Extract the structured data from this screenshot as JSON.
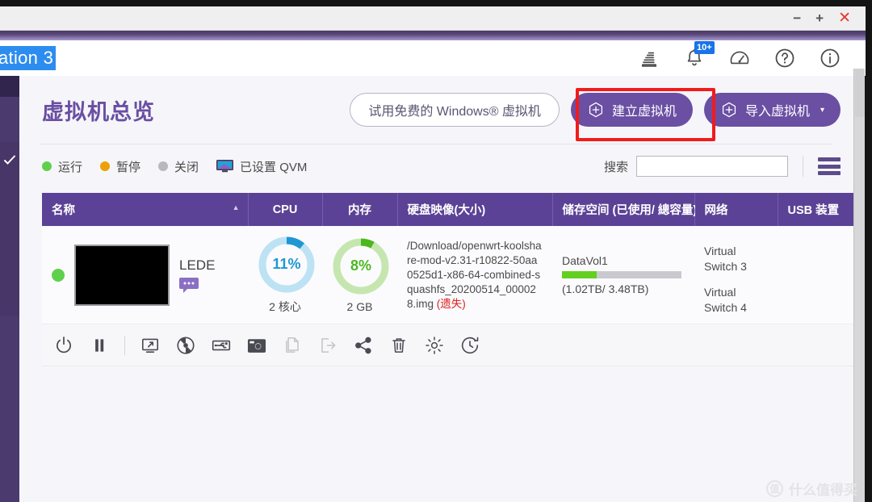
{
  "window": {
    "minimize_label": "−",
    "maximize_label": "+",
    "close_label": "✕",
    "app_title_fragment": "ation 3"
  },
  "header": {
    "icons": [
      {
        "name": "background-tasks-icon",
        "label": "背景任务"
      },
      {
        "name": "notification-bell-icon",
        "label": "通知",
        "badge": "10+"
      },
      {
        "name": "dashboard-gauge-icon",
        "label": "仪表板"
      },
      {
        "name": "help-icon",
        "label": "?"
      },
      {
        "name": "info-icon",
        "label": "i"
      }
    ]
  },
  "page": {
    "title": "虚拟机总览",
    "buttons": {
      "try_free_windows": "试用免费的 Windows® 虚拟机",
      "create_vm": "建立虚拟机",
      "import_vm": "导入虚拟机",
      "import_caret": "▾"
    }
  },
  "legend": {
    "items": [
      {
        "label": "运行",
        "color": "#5fd04b",
        "icon": "status-dot-running"
      },
      {
        "label": "暂停",
        "color": "#eda107",
        "icon": "status-dot-paused"
      },
      {
        "label": "关闭",
        "color": "#b8b8bd",
        "icon": "status-dot-stopped"
      },
      {
        "label": "已设置 QVM",
        "color": "#6a4fa3",
        "icon": "qvm-monitor-icon"
      }
    ]
  },
  "search": {
    "label": "搜索",
    "value": "",
    "placeholder": "",
    "menu_icon": "hamburger-menu-icon"
  },
  "table": {
    "columns": [
      {
        "key": "name",
        "label": "名称",
        "sorted": "asc",
        "sort_glyph": "▲"
      },
      {
        "key": "cpu",
        "label": "CPU"
      },
      {
        "key": "memory",
        "label": "内存"
      },
      {
        "key": "disk",
        "label": "硬盘映像(大小)"
      },
      {
        "key": "storage",
        "label": "储存空间 (已使用/ 總容量)"
      },
      {
        "key": "network",
        "label": "网络"
      },
      {
        "key": "usb",
        "label": "USB 装置"
      }
    ],
    "rows": [
      {
        "status": "running",
        "status_color": "#5fd04b",
        "thumbnail_alt": "vm-console-thumbnail",
        "name": "LEDE",
        "note_icon": "comment-icon",
        "cpu_percent": "11%",
        "cpu_value": 11,
        "cpu_color": "#2196d4",
        "cpu_track": "#bde2f4",
        "cpu_sub": "2 核心",
        "mem_percent": "8%",
        "mem_value": 8,
        "mem_color": "#4cb820",
        "mem_track": "#c6e6b0",
        "mem_sub": "2 GB",
        "disk_path": "/Download/openwrt-koolshare-mod-v2.31-r10822-50aa0525d1-x86-64-combined-squashfs_20200514_000028.img",
        "disk_state": "(遗失)",
        "storage_volume": "DataVol1",
        "storage_used_pct": 29,
        "storage_text": "(1.02TB/ 3.48TB)",
        "networks": [
          "Virtual Switch 3",
          "Virtual Switch 4"
        ],
        "usb": ""
      }
    ]
  },
  "actions": [
    {
      "name": "power-icon",
      "label": "开机/关机",
      "disabled": false
    },
    {
      "name": "pause-icon",
      "label": "暂停",
      "disabled": false
    },
    {
      "name": "separator",
      "label": "",
      "disabled": true
    },
    {
      "name": "console-icon",
      "label": "控制台",
      "disabled": false
    },
    {
      "name": "disc-icon",
      "label": "光碟映像",
      "disabled": false
    },
    {
      "name": "usb-icon",
      "label": "USB 装置",
      "disabled": false
    },
    {
      "name": "snapshot-camera-icon",
      "label": "快照",
      "disabled": false
    },
    {
      "name": "clone-icon",
      "label": "複製",
      "disabled": true
    },
    {
      "name": "export-icon",
      "label": "匯出",
      "disabled": true
    },
    {
      "name": "share-icon",
      "label": "共用",
      "disabled": false
    },
    {
      "name": "delete-trash-icon",
      "label": "刪除",
      "disabled": false
    },
    {
      "name": "settings-gear-icon",
      "label": "設定",
      "disabled": false
    },
    {
      "name": "history-clock-icon",
      "label": "歷程",
      "disabled": false
    }
  ],
  "watermark": {
    "text": "什么值得买",
    "logo": "值"
  },
  "colors": {
    "brand_purple": "#6a4fa3",
    "table_header": "#5b4296",
    "highlight_red": "#f21b1b",
    "running_green": "#5fd04b",
    "badge_blue": "#1a73e8"
  }
}
